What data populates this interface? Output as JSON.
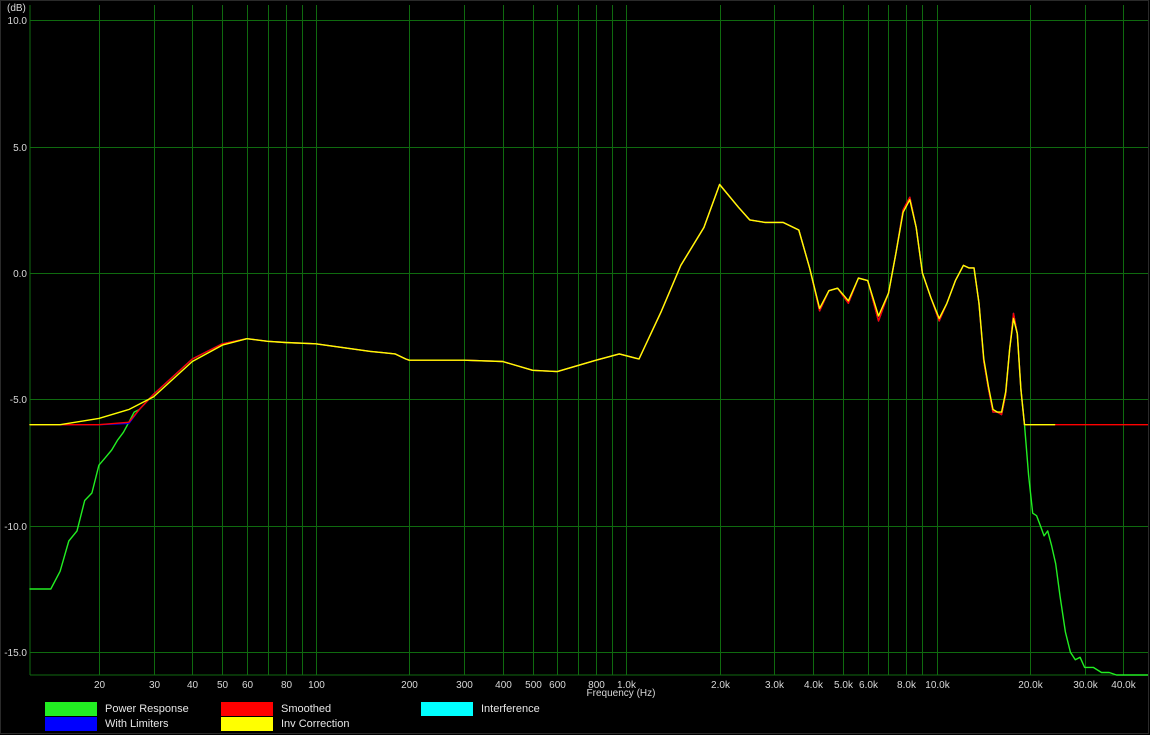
{
  "chart_data": {
    "type": "line",
    "ylabel": "(dB)",
    "xlabel": "Frequency (Hz)",
    "x_scale": "log",
    "xlim": [
      12,
      48000
    ],
    "ylim": [
      -15.9,
      10.6
    ],
    "grid": true,
    "y_ticks": [
      {
        "value": 10,
        "label": "10.0"
      },
      {
        "value": 5,
        "label": "5.0"
      },
      {
        "value": 0,
        "label": "0.0"
      },
      {
        "value": -5,
        "label": "-5.0"
      },
      {
        "value": -10,
        "label": "-10.0"
      },
      {
        "value": -15,
        "label": "-15.0"
      }
    ],
    "x_ticks": [
      {
        "value": 20,
        "label": "20"
      },
      {
        "value": 30,
        "label": "30"
      },
      {
        "value": 40,
        "label": "40"
      },
      {
        "value": 50,
        "label": "50"
      },
      {
        "value": 60,
        "label": "60"
      },
      {
        "value": 80,
        "label": "80"
      },
      {
        "value": 100,
        "label": "100"
      },
      {
        "value": 200,
        "label": "200"
      },
      {
        "value": 300,
        "label": "300"
      },
      {
        "value": 400,
        "label": "400"
      },
      {
        "value": 500,
        "label": "500"
      },
      {
        "value": 600,
        "label": "600"
      },
      {
        "value": 800,
        "label": "800"
      },
      {
        "value": 1000,
        "label": "1.0k"
      },
      {
        "value": 2000,
        "label": "2.0k"
      },
      {
        "value": 3000,
        "label": "3.0k"
      },
      {
        "value": 4000,
        "label": "4.0k"
      },
      {
        "value": 5000,
        "label": "5.0k"
      },
      {
        "value": 6000,
        "label": "6.0k"
      },
      {
        "value": 8000,
        "label": "8.0k"
      },
      {
        "value": 10000,
        "label": "10.0k"
      },
      {
        "value": 20000,
        "label": "20.0k"
      },
      {
        "value": 30000,
        "label": "30.0k"
      },
      {
        "value": 40000,
        "label": "40.0k"
      }
    ],
    "minor_gridlines": [
      70,
      90,
      700,
      900,
      7000,
      9000
    ],
    "legend_placement": "bottom",
    "legend": [
      {
        "name": "Power Response",
        "color": "#22ee22"
      },
      {
        "name": "With Limiters",
        "color": "#0000ff"
      },
      {
        "name": "Smoothed",
        "color": "#ff0000"
      },
      {
        "name": "Inv Correction",
        "color": "#ffff00"
      },
      {
        "name": "Interference",
        "color": "#00ffff"
      }
    ],
    "series": [
      {
        "name": "Power Response",
        "color": "#22ee22",
        "x": [
          12,
          14,
          15,
          16,
          17,
          18,
          19,
          20,
          21,
          22,
          23,
          24,
          25,
          26,
          27,
          30,
          40,
          50,
          60,
          70,
          80,
          100,
          150,
          180,
          195,
          200,
          300,
          400,
          500,
          600,
          800,
          950,
          1100,
          1300,
          1500,
          1780,
          2000,
          2300,
          2500,
          2800,
          3200,
          3600,
          3900,
          4200,
          4500,
          4800,
          5200,
          5600,
          6000,
          6500,
          7000,
          7400,
          7800,
          8200,
          8600,
          9000,
          9600,
          10200,
          10800,
          11500,
          12200,
          12700,
          13200,
          13700,
          14200,
          14700,
          15200,
          15700,
          16200,
          16700,
          17200,
          17700,
          18200,
          18700,
          19200,
          19800,
          20400,
          21000,
          21600,
          22200,
          22800,
          23500,
          24200,
          25000,
          26000,
          27000,
          28000,
          29000,
          30000,
          32000,
          34000,
          36000,
          38000,
          40000,
          45000,
          48000
        ],
        "y": [
          -12.5,
          -12.5,
          -11.8,
          -10.6,
          -10.2,
          -9.0,
          -8.7,
          -7.6,
          -7.3,
          -7.0,
          -6.6,
          -6.3,
          -5.9,
          -5.5,
          -5.4,
          -4.8,
          -3.4,
          -2.8,
          -2.6,
          -2.7,
          -2.75,
          -2.8,
          -3.1,
          -3.2,
          -3.4,
          -3.45,
          -3.45,
          -3.5,
          -3.85,
          -3.9,
          -3.45,
          -3.2,
          -3.4,
          -1.5,
          0.3,
          1.8,
          3.5,
          2.6,
          2.1,
          2.0,
          2.0,
          1.7,
          0.2,
          -1.5,
          -0.7,
          -0.6,
          -1.2,
          -0.2,
          -0.3,
          -1.9,
          -0.8,
          0.8,
          2.5,
          3.0,
          1.8,
          0.0,
          -1.0,
          -1.9,
          -1.2,
          -0.3,
          0.3,
          0.2,
          0.2,
          -1.2,
          -3.5,
          -4.6,
          -5.5,
          -5.5,
          -5.6,
          -4.8,
          -3.0,
          -1.6,
          -2.4,
          -4.6,
          -6.0,
          -8.0,
          -9.5,
          -9.6,
          -10.0,
          -10.4,
          -10.2,
          -10.8,
          -11.5,
          -12.8,
          -14.2,
          -15.0,
          -15.3,
          -15.2,
          -15.6,
          -15.6,
          -15.8,
          -15.8,
          -15.9,
          -15.9,
          -15.9,
          -15.9
        ]
      },
      {
        "name": "With Limiters",
        "color": "#0000ff",
        "x": [
          12,
          20,
          25,
          27,
          30,
          40,
          50,
          60,
          70,
          80,
          100,
          150,
          180,
          195,
          200,
          300,
          400,
          500,
          600,
          800,
          950,
          1100,
          1300,
          1500,
          1780,
          2000,
          2300,
          2500,
          2800,
          3200,
          3600,
          3900,
          4200,
          4500,
          4800,
          5200,
          5600,
          6000,
          6500,
          7000,
          7400,
          7800,
          8200,
          8600,
          9000,
          9600,
          10200,
          10800,
          11500,
          12200,
          12700,
          13200,
          13700,
          14200,
          14700,
          15200,
          15700,
          16200,
          16700,
          17200,
          17700,
          18200,
          18700,
          19200,
          20000,
          24000
        ],
        "y": [
          -6.0,
          -6.0,
          -5.95,
          -5.4,
          -4.8,
          -3.4,
          -2.8,
          -2.6,
          -2.7,
          -2.75,
          -2.8,
          -3.1,
          -3.2,
          -3.4,
          -3.45,
          -3.45,
          -3.5,
          -3.85,
          -3.9,
          -3.45,
          -3.2,
          -3.4,
          -1.5,
          0.3,
          1.8,
          3.5,
          2.6,
          2.1,
          2.0,
          2.0,
          1.7,
          0.2,
          -1.5,
          -0.7,
          -0.6,
          -1.2,
          -0.2,
          -0.3,
          -1.9,
          -0.8,
          0.8,
          2.5,
          3.0,
          1.8,
          0.0,
          -1.0,
          -1.9,
          -1.2,
          -0.3,
          0.3,
          0.2,
          0.2,
          -1.2,
          -3.5,
          -4.6,
          -5.5,
          -5.5,
          -5.6,
          -4.8,
          -3.0,
          -1.6,
          -2.4,
          -4.6,
          -6.0,
          -6.0,
          -6.0
        ]
      },
      {
        "name": "Smoothed",
        "color": "#ff0000",
        "x": [
          12,
          20,
          25,
          27,
          30,
          40,
          50,
          60,
          70,
          80,
          100,
          150,
          180,
          195,
          200,
          300,
          400,
          500,
          600,
          800,
          950,
          1100,
          1300,
          1500,
          1780,
          2000,
          2300,
          2500,
          2800,
          3200,
          3600,
          3900,
          4200,
          4500,
          4800,
          5200,
          5600,
          6000,
          6500,
          7000,
          7400,
          7800,
          8200,
          8600,
          9000,
          9600,
          10200,
          10800,
          11500,
          12200,
          12700,
          13200,
          13700,
          14200,
          14700,
          15200,
          15700,
          16200,
          16700,
          17200,
          17700,
          18200,
          18700,
          19200,
          20000,
          48000
        ],
        "y": [
          -6.0,
          -6.0,
          -5.9,
          -5.4,
          -4.8,
          -3.4,
          -2.8,
          -2.6,
          -2.7,
          -2.75,
          -2.8,
          -3.1,
          -3.2,
          -3.4,
          -3.45,
          -3.45,
          -3.5,
          -3.85,
          -3.9,
          -3.45,
          -3.2,
          -3.4,
          -1.5,
          0.3,
          1.8,
          3.5,
          2.6,
          2.1,
          2.0,
          2.0,
          1.7,
          0.2,
          -1.5,
          -0.7,
          -0.6,
          -1.2,
          -0.2,
          -0.3,
          -1.9,
          -0.8,
          0.8,
          2.5,
          3.0,
          1.8,
          0.0,
          -1.0,
          -1.9,
          -1.2,
          -0.3,
          0.3,
          0.2,
          0.2,
          -1.2,
          -3.5,
          -4.6,
          -5.5,
          -5.5,
          -5.6,
          -4.8,
          -3.0,
          -1.6,
          -2.4,
          -4.6,
          -6.0,
          -6.0,
          -6.0
        ]
      },
      {
        "name": "Inv Correction",
        "color": "#ffff00",
        "x": [
          12,
          15,
          20,
          25,
          30,
          40,
          50,
          60,
          70,
          80,
          100,
          150,
          180,
          195,
          200,
          300,
          400,
          500,
          600,
          800,
          950,
          1100,
          1300,
          1500,
          1780,
          2000,
          2300,
          2500,
          2800,
          3200,
          3600,
          3900,
          4200,
          4500,
          4800,
          5200,
          5600,
          6000,
          6500,
          7000,
          7400,
          7800,
          8200,
          8600,
          9000,
          9600,
          10200,
          10800,
          11500,
          12200,
          12700,
          13200,
          13700,
          14200,
          14700,
          15200,
          15700,
          16200,
          16700,
          17200,
          17700,
          18200,
          18700,
          19200,
          20000,
          24000
        ],
        "y": [
          -6.0,
          -6.0,
          -5.75,
          -5.4,
          -4.9,
          -3.5,
          -2.85,
          -2.6,
          -2.7,
          -2.75,
          -2.8,
          -3.1,
          -3.2,
          -3.4,
          -3.45,
          -3.45,
          -3.5,
          -3.85,
          -3.9,
          -3.45,
          -3.2,
          -3.4,
          -1.5,
          0.3,
          1.8,
          3.5,
          2.6,
          2.1,
          2.0,
          2.0,
          1.7,
          0.2,
          -1.4,
          -0.7,
          -0.6,
          -1.1,
          -0.2,
          -0.3,
          -1.7,
          -0.8,
          0.8,
          2.4,
          2.9,
          1.8,
          0.0,
          -1.0,
          -1.8,
          -1.2,
          -0.3,
          0.3,
          0.2,
          0.2,
          -1.2,
          -3.4,
          -4.5,
          -5.4,
          -5.5,
          -5.5,
          -4.7,
          -3.0,
          -1.8,
          -2.4,
          -4.6,
          -6.0,
          -6.0,
          -6.0
        ]
      }
    ]
  }
}
